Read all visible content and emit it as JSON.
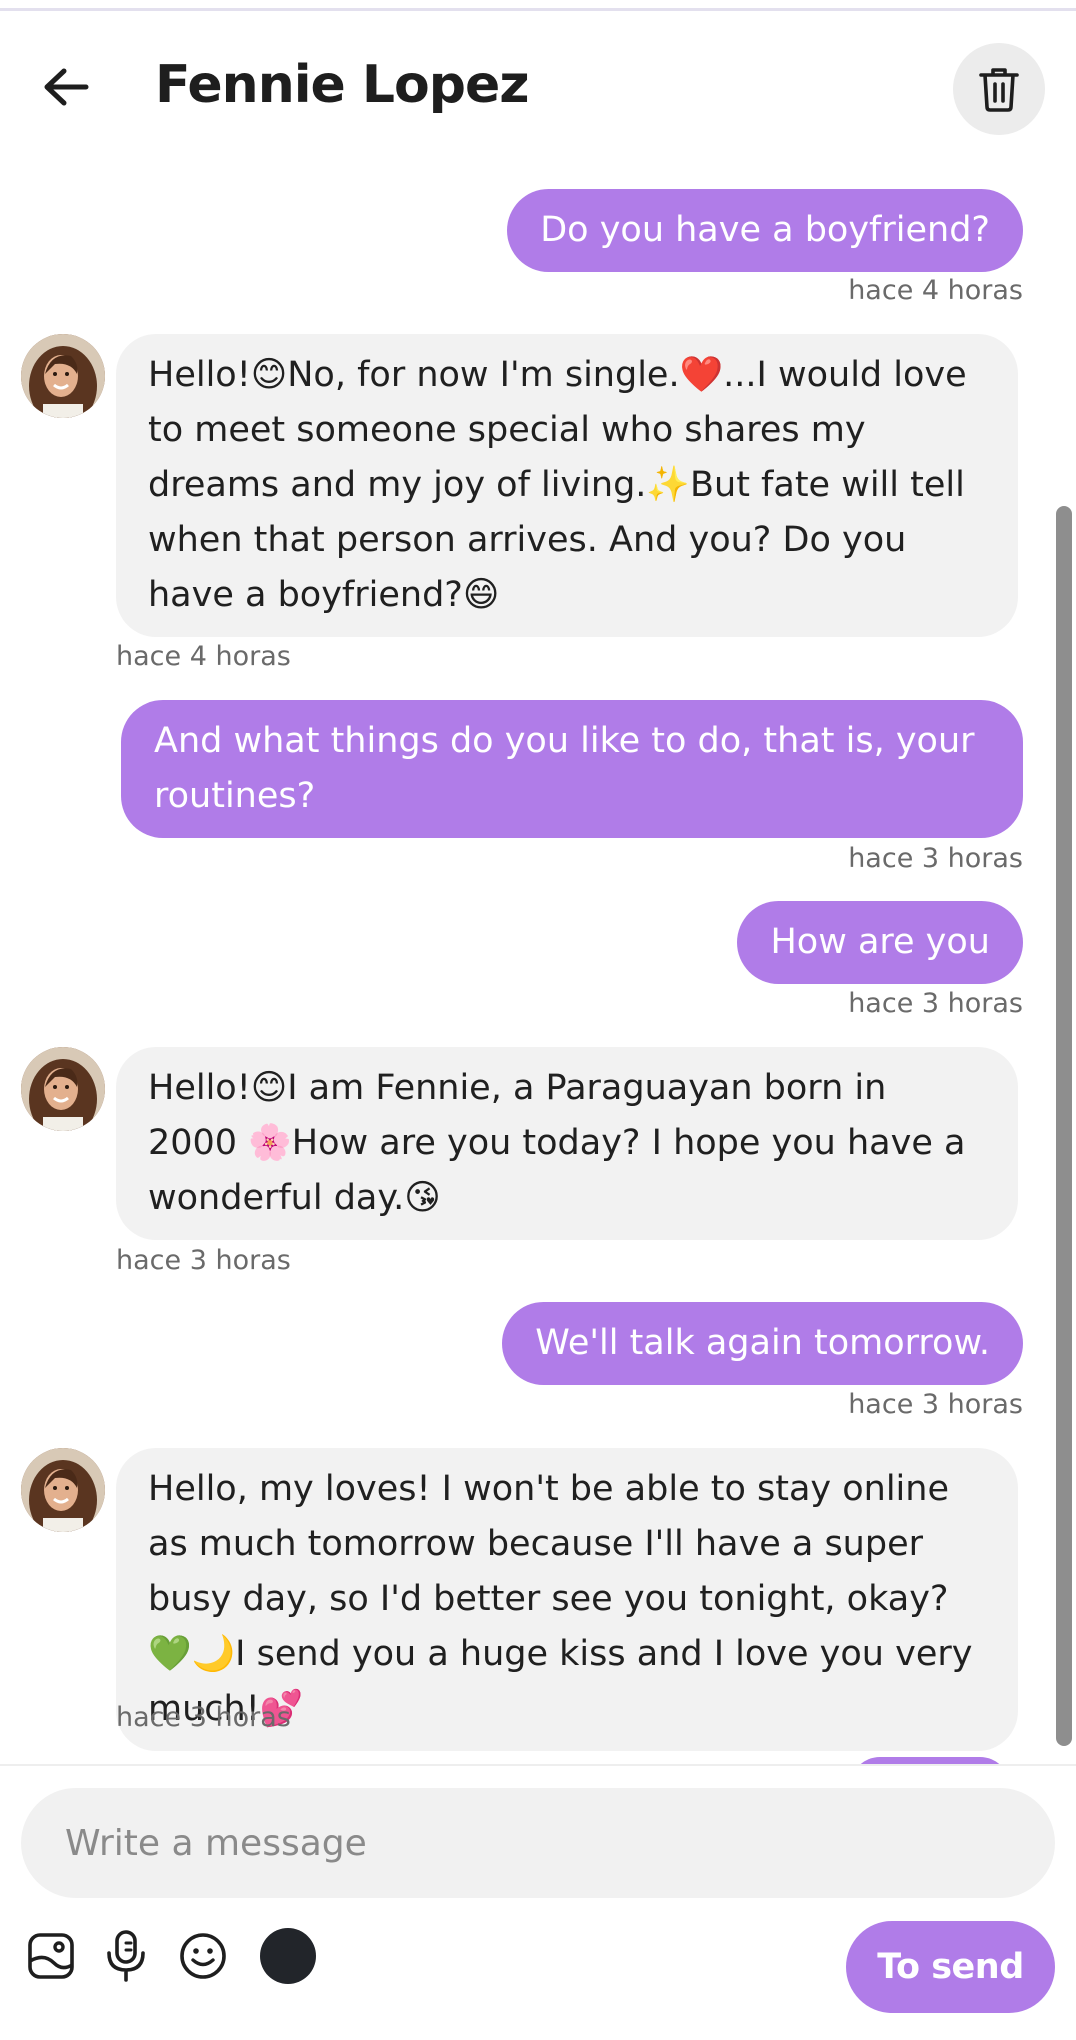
{
  "header": {
    "title": "Fennie Lopez",
    "back_icon": "arrow-left-icon",
    "delete_icon": "trash-icon"
  },
  "messages": [
    {
      "direction": "out",
      "text": "Do you have a boyfriend?",
      "time": "hace 4 horas"
    },
    {
      "direction": "in",
      "text": "Hello!😊No, for now I'm single.❤️...I would love to meet someone special who shares my dreams and my joy of living.✨But fate will tell when that person arrives. And you? Do you have a boyfriend?😄",
      "time": "hace 4 horas"
    },
    {
      "direction": "out",
      "text": "And what things do you like to do, that is, your routines?",
      "time": "hace 3 horas"
    },
    {
      "direction": "out",
      "text": "How are you",
      "time": "hace 3 horas"
    },
    {
      "direction": "in",
      "text": "Hello!😊I am Fennie, a Paraguayan born in 2000 🌸How are you today? I hope you have a wonderful day.😘",
      "time": "hace 3 horas"
    },
    {
      "direction": "out",
      "text": "We'll talk again tomorrow.",
      "time": "hace 3 horas"
    },
    {
      "direction": "in",
      "text": "Hello, my loves!   I won't be able to stay online as much tomorrow because I'll have a super busy day, so I'd better see you tonight, okay?💚🌙I send you a huge kiss and I love you very much!💕",
      "time": "hace 3 horas"
    }
  ],
  "composer": {
    "placeholder": "Write a message",
    "send_label": "To send",
    "tools": [
      "image-icon",
      "microphone-icon",
      "emoji-icon",
      "color-picker"
    ],
    "color_swatch": "#22252a"
  },
  "colors": {
    "accent": "#b07ce8",
    "incoming_bubble": "#f2f2f2",
    "timestamp": "#6a6a6a"
  }
}
